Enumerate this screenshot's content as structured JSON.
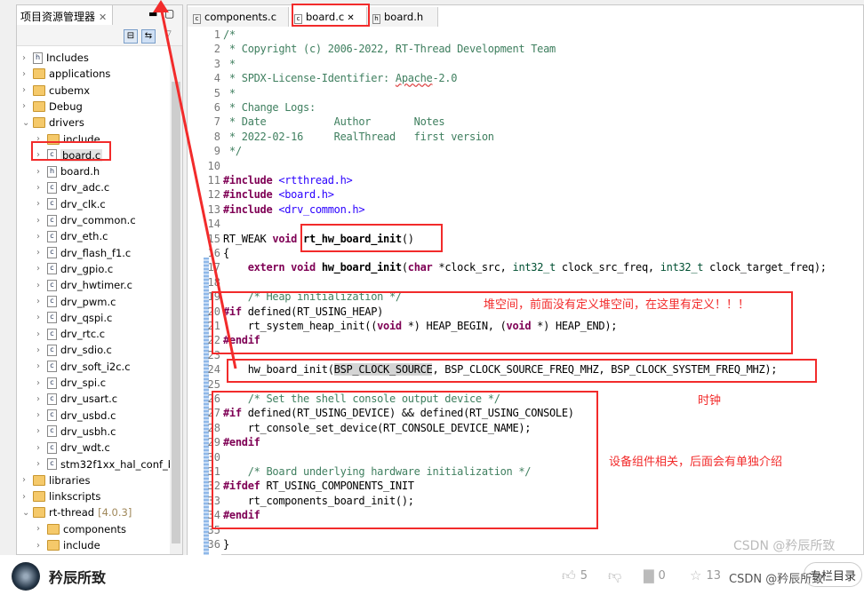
{
  "explorer": {
    "title": "项目资源管理器",
    "items": [
      {
        "label": "Includes",
        "level": 1,
        "icon": "includes-icon",
        "expanded": false
      },
      {
        "label": "applications",
        "level": 1,
        "icon": "folder-icon",
        "expanded": false
      },
      {
        "label": "cubemx",
        "level": 1,
        "icon": "folder-icon",
        "expanded": false
      },
      {
        "label": "Debug",
        "level": 1,
        "icon": "folder-icon",
        "expanded": false
      },
      {
        "label": "drivers",
        "level": 1,
        "icon": "folder-icon",
        "expanded": true
      },
      {
        "label": "include",
        "level": 2,
        "icon": "folder-icon",
        "expanded": false
      },
      {
        "label": "board.c",
        "level": 2,
        "icon": "c-file-icon",
        "selected": true
      },
      {
        "label": "board.h",
        "level": 2,
        "icon": "h-file-icon"
      },
      {
        "label": "drv_adc.c",
        "level": 2,
        "icon": "c-file-icon"
      },
      {
        "label": "drv_clk.c",
        "level": 2,
        "icon": "c-file-icon"
      },
      {
        "label": "drv_common.c",
        "level": 2,
        "icon": "c-file-icon"
      },
      {
        "label": "drv_eth.c",
        "level": 2,
        "icon": "c-file-icon"
      },
      {
        "label": "drv_flash_f1.c",
        "level": 2,
        "icon": "c-file-icon"
      },
      {
        "label": "drv_gpio.c",
        "level": 2,
        "icon": "c-file-icon"
      },
      {
        "label": "drv_hwtimer.c",
        "level": 2,
        "icon": "c-file-icon"
      },
      {
        "label": "drv_pwm.c",
        "level": 2,
        "icon": "c-file-icon"
      },
      {
        "label": "drv_qspi.c",
        "level": 2,
        "icon": "c-file-icon"
      },
      {
        "label": "drv_rtc.c",
        "level": 2,
        "icon": "c-file-icon"
      },
      {
        "label": "drv_sdio.c",
        "level": 2,
        "icon": "c-file-icon"
      },
      {
        "label": "drv_soft_i2c.c",
        "level": 2,
        "icon": "c-file-icon"
      },
      {
        "label": "drv_spi.c",
        "level": 2,
        "icon": "c-file-icon"
      },
      {
        "label": "drv_usart.c",
        "level": 2,
        "icon": "c-file-icon"
      },
      {
        "label": "drv_usbd.c",
        "level": 2,
        "icon": "c-file-icon"
      },
      {
        "label": "drv_usbh.c",
        "level": 2,
        "icon": "c-file-icon"
      },
      {
        "label": "drv_wdt.c",
        "level": 2,
        "icon": "c-file-icon"
      },
      {
        "label": "stm32f1xx_hal_conf_ba",
        "level": 2,
        "icon": "c-file-icon"
      },
      {
        "label": "libraries",
        "level": 1,
        "icon": "folder-icon",
        "expanded": false
      },
      {
        "label": "linkscripts",
        "level": 1,
        "icon": "folder-icon",
        "expanded": false
      },
      {
        "label": "rt-thread",
        "version": "[4.0.3]",
        "level": 1,
        "icon": "folder-icon",
        "expanded": true
      },
      {
        "label": "components",
        "level": 2,
        "icon": "folder-icon",
        "expanded": false
      },
      {
        "label": "include",
        "level": 2,
        "icon": "folder-icon",
        "expanded": false
      }
    ]
  },
  "editor": {
    "tabs": [
      {
        "label": "components.c",
        "icon": "c-file-icon"
      },
      {
        "label": "board.c",
        "icon": "c-file-icon",
        "active": true
      },
      {
        "label": "board.h",
        "icon": "h-file-icon"
      }
    ],
    "lines": [
      [
        [
          "/*",
          "cm"
        ]
      ],
      [
        [
          " * Copyright (c) 2006-2022, RT-Thread Development Team",
          "cm"
        ]
      ],
      [
        [
          " *",
          "cm"
        ]
      ],
      [
        [
          " * SPDX-License-Identifier: ",
          "cm"
        ],
        [
          "Apache",
          "cm ul"
        ],
        [
          "-2.0",
          "cm"
        ]
      ],
      [
        [
          " *",
          "cm"
        ]
      ],
      [
        [
          " * Change Logs:",
          "cm"
        ]
      ],
      [
        [
          " * Date           Author       Notes",
          "cm"
        ]
      ],
      [
        [
          " * 2022-02-16     RealThread   first version",
          "cm"
        ]
      ],
      [
        [
          " */",
          "cm"
        ]
      ],
      [
        [
          "",
          ""
        ]
      ],
      [
        [
          "#include ",
          "kw"
        ],
        [
          "<rtthread.h>",
          "inc"
        ]
      ],
      [
        [
          "#include ",
          "kw"
        ],
        [
          "<board.h>",
          "inc"
        ]
      ],
      [
        [
          "#include ",
          "kw"
        ],
        [
          "<drv_common.h>",
          "inc"
        ]
      ],
      [
        [
          "",
          ""
        ]
      ],
      [
        [
          "RT_WEAK ",
          ""
        ],
        [
          "void ",
          "kw"
        ],
        [
          "rt_hw_board_init",
          "fn"
        ],
        [
          "()",
          ""
        ]
      ],
      [
        [
          "{",
          ""
        ]
      ],
      [
        [
          "    ",
          ""
        ],
        [
          "extern void ",
          "kw"
        ],
        [
          "hw_board_init",
          "fn"
        ],
        [
          "(",
          ""
        ],
        [
          "char ",
          "kw"
        ],
        [
          "*clock_src, ",
          ""
        ],
        [
          "int32_t ",
          "ty"
        ],
        [
          "clock_src_freq, ",
          ""
        ],
        [
          "int32_t ",
          "ty"
        ],
        [
          "clock_target_freq);",
          ""
        ]
      ],
      [
        [
          "",
          ""
        ]
      ],
      [
        [
          "    ",
          ""
        ],
        [
          "/* Heap initialization */",
          "cm"
        ]
      ],
      [
        [
          "#if ",
          "kw"
        ],
        [
          "defined(RT_USING_HEAP)",
          ""
        ]
      ],
      [
        [
          "    rt_system_heap_init((",
          ""
        ],
        [
          "void ",
          "kw"
        ],
        [
          "*) HEAP_BEGIN, (",
          ""
        ],
        [
          "void ",
          "kw"
        ],
        [
          "*) HEAP_END);",
          ""
        ]
      ],
      [
        [
          "#endif",
          "kw"
        ]
      ],
      [
        [
          "",
          ""
        ]
      ],
      [
        [
          "    hw_board_init(",
          ""
        ],
        [
          "BSP_CLOCK_SOURCE",
          "hl"
        ],
        [
          ", BSP_CLOCK_SOURCE_FREQ_MHZ, BSP_CLOCK_SYSTEM_FREQ_MHZ);",
          ""
        ]
      ],
      [
        [
          "",
          ""
        ]
      ],
      [
        [
          "    ",
          ""
        ],
        [
          "/* Set the shell console output device */",
          "cm"
        ]
      ],
      [
        [
          "#if ",
          "kw"
        ],
        [
          "defined(RT_USING_DEVICE) && defined(RT_USING_CONSOLE)",
          ""
        ]
      ],
      [
        [
          "    rt_console_set_device(RT_CONSOLE_DEVICE_NAME);",
          ""
        ]
      ],
      [
        [
          "#endif",
          "kw"
        ]
      ],
      [
        [
          "",
          ""
        ]
      ],
      [
        [
          "    ",
          ""
        ],
        [
          "/* Board underlying hardware initialization */",
          "cm"
        ]
      ],
      [
        [
          "#ifdef ",
          "kw"
        ],
        [
          "RT_USING_COMPONENTS_INIT",
          ""
        ]
      ],
      [
        [
          "    rt_components_board_init();",
          ""
        ]
      ],
      [
        [
          "#endif",
          "kw"
        ]
      ],
      [
        [
          "",
          ""
        ]
      ],
      [
        [
          "}",
          ""
        ]
      ]
    ]
  },
  "annotations": {
    "heap": "堆空间，前面没有定义堆空间，在这里有定义！！！",
    "clock": "时钟",
    "device": "设备组件相关，后面会有单独介绍",
    "color": "#f22b2b"
  },
  "watermark": "CSDN @矜辰所致",
  "footer": {
    "author": "矜辰所致",
    "likes": "5",
    "comments": "0",
    "favorites": "13",
    "watermark": "CSDN @矜辰所致",
    "column_button": "专栏目录"
  }
}
